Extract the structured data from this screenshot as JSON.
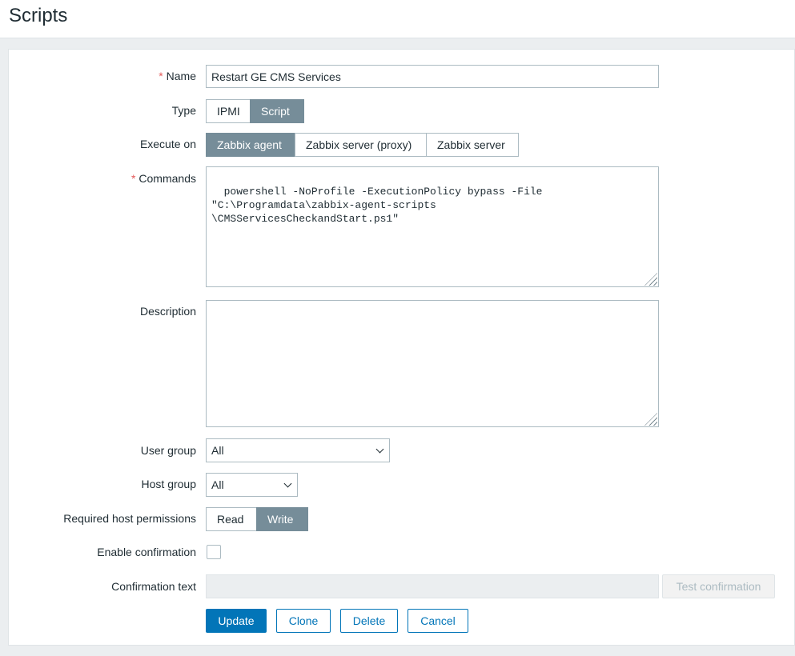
{
  "page": {
    "title": "Scripts"
  },
  "form": {
    "name": {
      "label": "Name",
      "required_mark": "*",
      "value": "Restart GE CMS Services"
    },
    "type": {
      "label": "Type",
      "options": [
        "IPMI",
        "Script"
      ],
      "selected": "Script"
    },
    "execute_on": {
      "label": "Execute on",
      "options": [
        "Zabbix agent",
        "Zabbix server (proxy)",
        "Zabbix server"
      ],
      "selected": "Zabbix agent"
    },
    "commands": {
      "label": "Commands",
      "required_mark": "*",
      "value": "powershell -NoProfile -ExecutionPolicy bypass -File \"C:\\Programdata\\zabbix-agent-scripts\n\\CMSServicesCheckandStart.ps1\""
    },
    "description": {
      "label": "Description",
      "value": ""
    },
    "user_group": {
      "label": "User group",
      "value": "All"
    },
    "host_group": {
      "label": "Host group",
      "value": "All"
    },
    "host_permissions": {
      "label": "Required host permissions",
      "options": [
        "Read",
        "Write"
      ],
      "selected": "Write"
    },
    "enable_confirmation": {
      "label": "Enable confirmation",
      "checked": false
    },
    "confirmation_text": {
      "label": "Confirmation text",
      "value": "",
      "test_button": "Test confirmation"
    }
  },
  "actions": {
    "update": "Update",
    "clone": "Clone",
    "delete": "Delete",
    "cancel": "Cancel"
  },
  "colors": {
    "primary": "#0275b8",
    "selected": "#768d99",
    "required": "#e45959"
  }
}
